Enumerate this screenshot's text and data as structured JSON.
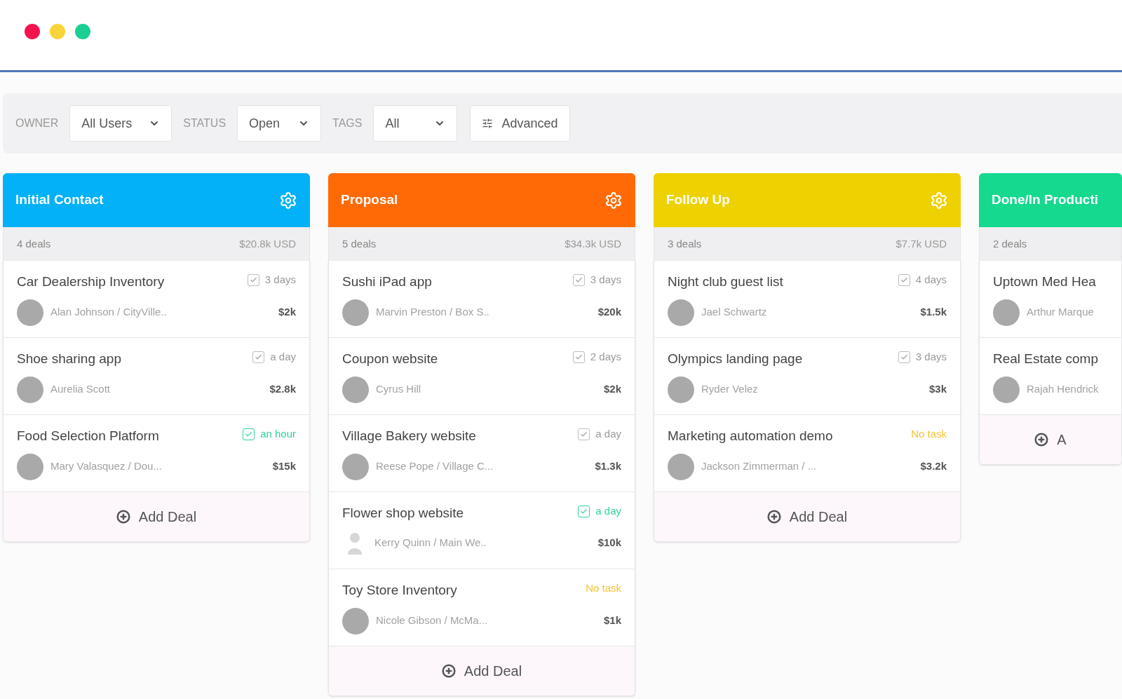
{
  "filters": [
    {
      "label": "OWNER",
      "value": "All Users"
    },
    {
      "label": "STATUS",
      "value": "Open"
    },
    {
      "label": "TAGS",
      "value": "All"
    }
  ],
  "advanced_button": "Advanced",
  "columns": [
    {
      "title": "Initial Contact",
      "color": "#02b1f7",
      "count": "4 deals",
      "total": "$20.8k USD",
      "add_label": "Add Deal",
      "deals": [
        {
          "title": "Car Dealership Inventory",
          "task": {
            "kind": "task",
            "checked": true,
            "urgent": false,
            "label": "3 days"
          },
          "person": "Alan Johnson / CityVille..",
          "silhouette": false,
          "amount": "$2k"
        },
        {
          "title": "Shoe sharing app",
          "task": {
            "kind": "task",
            "checked": true,
            "urgent": false,
            "label": "a day"
          },
          "person": "Aurelia Scott",
          "silhouette": false,
          "amount": "$2.8k"
        },
        {
          "title": "Food Selection Platform",
          "task": {
            "kind": "task",
            "checked": true,
            "urgent": true,
            "label": "an hour"
          },
          "person": "Mary Valasquez / Dou...",
          "silhouette": false,
          "amount": "$15k"
        }
      ]
    },
    {
      "title": "Proposal",
      "color": "#ff6a06",
      "count": "5 deals",
      "total": "$34.3k USD",
      "add_label": "Add Deal",
      "deals": [
        {
          "title": "Sushi iPad app",
          "task": {
            "kind": "task",
            "checked": true,
            "urgent": false,
            "label": "3 days"
          },
          "person": "Marvin Preston / Box S..",
          "silhouette": false,
          "amount": "$20k"
        },
        {
          "title": "Coupon website",
          "task": {
            "kind": "task",
            "checked": true,
            "urgent": false,
            "label": "2 days"
          },
          "person": "Cyrus Hill",
          "silhouette": false,
          "amount": "$2k"
        },
        {
          "title": "Village Bakery website",
          "task": {
            "kind": "task",
            "checked": true,
            "urgent": false,
            "label": "a day"
          },
          "person": "Reese Pope / Village C...",
          "silhouette": false,
          "amount": "$1.3k"
        },
        {
          "title": "Flower shop website",
          "task": {
            "kind": "task",
            "checked": true,
            "urgent": true,
            "label": "a day"
          },
          "person": "Kerry Quinn / Main We..",
          "silhouette": true,
          "amount": "$10k"
        },
        {
          "title": "Toy Store Inventory",
          "task": {
            "kind": "none",
            "label": "No task"
          },
          "person": "Nicole Gibson / McMa...",
          "silhouette": false,
          "amount": "$1k"
        }
      ]
    },
    {
      "title": "Follow Up",
      "color": "#eed100",
      "count": "3 deals",
      "total": "$7.7k USD",
      "add_label": "Add Deal",
      "deals": [
        {
          "title": "Night club guest list",
          "task": {
            "kind": "task",
            "checked": true,
            "urgent": false,
            "label": "4 days"
          },
          "person": "Jael Schwartz",
          "silhouette": false,
          "amount": "$1.5k"
        },
        {
          "title": "Olympics landing page",
          "task": {
            "kind": "task",
            "checked": true,
            "urgent": false,
            "label": "3 days"
          },
          "person": "Ryder Velez",
          "silhouette": false,
          "amount": "$3k"
        },
        {
          "title": "Marketing automation demo",
          "task": {
            "kind": "none",
            "label": "No task"
          },
          "person": "Jackson Zimmerman / ...",
          "silhouette": false,
          "amount": "$3.2k"
        }
      ]
    },
    {
      "title": "Done/In Producti",
      "color": "#14d98f",
      "count": "2 deals",
      "add_label": "A",
      "deals": [
        {
          "title": "Uptown Med Hea",
          "person": "Arthur Marque",
          "silhouette": false
        },
        {
          "title": "Real Estate comp",
          "person": "Rajah Hendrick",
          "silhouette": false
        }
      ]
    }
  ]
}
